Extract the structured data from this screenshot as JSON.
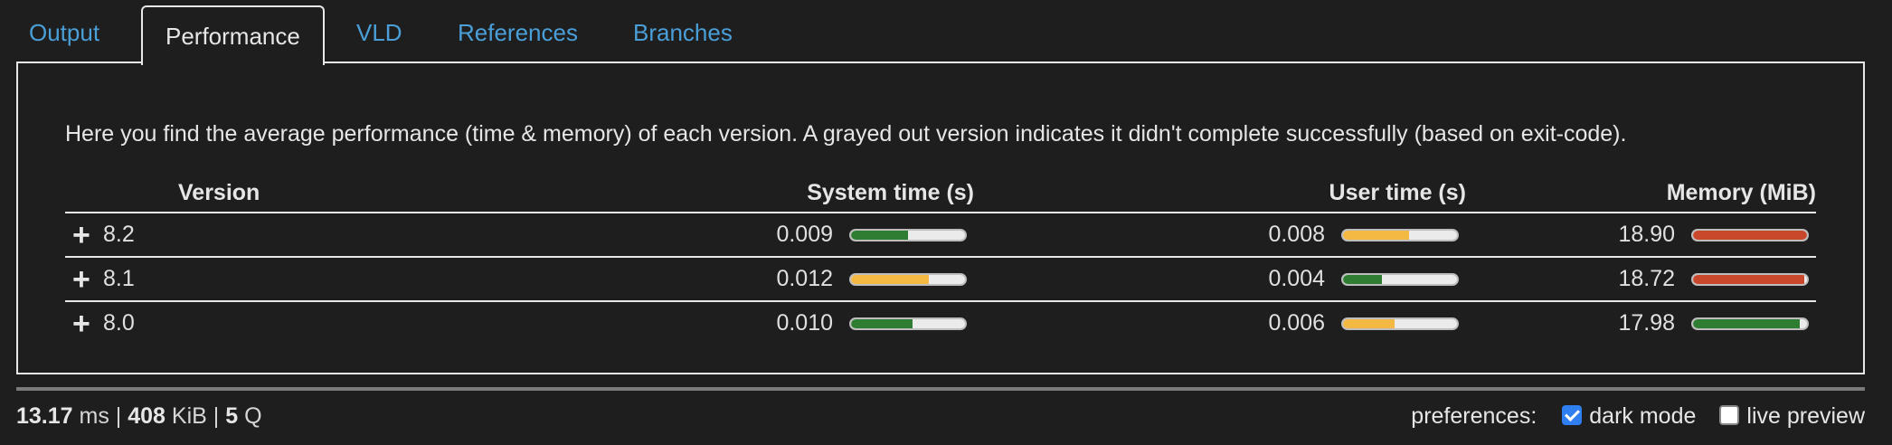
{
  "tabs": [
    {
      "label": "Output",
      "active": false
    },
    {
      "label": "Performance",
      "active": true
    },
    {
      "label": "VLD",
      "active": false
    },
    {
      "label": "References",
      "active": false
    },
    {
      "label": "Branches",
      "active": false
    }
  ],
  "intro": "Here you find the average performance (time & memory) of each version. A grayed out version indicates it didn't complete successfully (based on exit-code).",
  "table": {
    "headers": {
      "version": "Version",
      "system": "System time (s)",
      "user": "User time (s)",
      "memory": "Memory (MiB)"
    },
    "rows": [
      {
        "version": "8.2",
        "system": "0.009",
        "user": "0.008",
        "memory": "18.90",
        "system_level": 0.5,
        "user_level": 0.58,
        "memory_level": 1.0,
        "system_color": "#2e7d32",
        "user_color": "#f4b942",
        "memory_color": "#c9472b"
      },
      {
        "version": "8.1",
        "system": "0.012",
        "user": "0.004",
        "memory": "18.72",
        "system_level": 0.68,
        "user_level": 0.34,
        "memory_level": 0.98,
        "system_color": "#f4b942",
        "user_color": "#2e7d32",
        "memory_color": "#c9472b"
      },
      {
        "version": "8.0",
        "system": "0.010",
        "user": "0.006",
        "memory": "17.98",
        "system_level": 0.54,
        "user_level": 0.45,
        "memory_level": 0.94,
        "system_color": "#2e7d32",
        "user_color": "#f4b942",
        "memory_color": "#2e7d32"
      }
    ]
  },
  "stats": {
    "ms": "13.17",
    "ms_unit": "ms",
    "kib": "408",
    "kib_unit": "KiB",
    "q": "5",
    "q_unit": "Q",
    "sep": "|"
  },
  "preferences": {
    "label": "preferences:",
    "dark_mode": {
      "label": "dark mode",
      "checked": true
    },
    "live_preview": {
      "label": "live preview",
      "checked": false
    }
  }
}
